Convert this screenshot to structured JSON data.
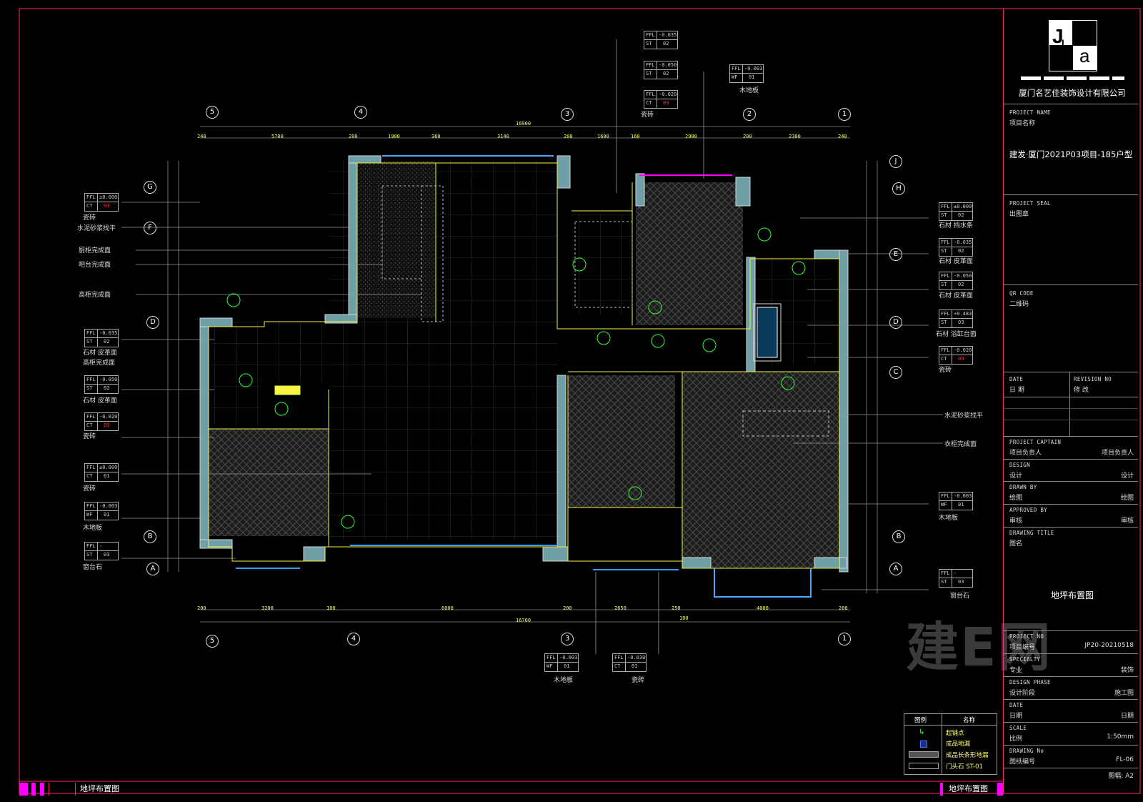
{
  "title_block": {
    "company": "厦门名艺佳装饰设计有限公司",
    "logo_text": "JLa",
    "project_name_en": "PROJECT NAME",
    "project_name_cn": "项目名称",
    "project_name_value": "建发·厦门2021P03项目-185户型",
    "project_seal_en": "PROJECT SEAL",
    "project_seal_cn": "出图章",
    "qr_en": "QR CODE",
    "qr_cn": "二维码",
    "date_en": "DATE",
    "date_cn": "日 期",
    "revision_en": "REVISION NO",
    "revision_cn": "修 改",
    "captain_en": "PROJECT CAPTAIN",
    "captain_cn": "项目负责人",
    "captain_value": "项目负责人",
    "design_en": "DESIGN",
    "design_cn": "设计",
    "design_value": "设计",
    "drawn_en": "DRAWN BY",
    "drawn_cn": "绘图",
    "drawn_value": "绘图",
    "approved_en": "APPROVED BY",
    "approved_cn": "审核",
    "approved_value": "审核",
    "dtitle_en": "DRAWING TITLE",
    "dtitle_cn": "图名",
    "drawing_title": "地坪布置图",
    "project_no_en": "PROJECT NO",
    "project_no_cn": "项目编号",
    "project_no_value": "JP20-20210518",
    "specialty_en": "SPECIALTY",
    "specialty_cn": "专业",
    "specialty_value": "装饰",
    "phase_en": "DESIGN PHASE",
    "phase_cn": "设计阶段",
    "phase_value": "施工图",
    "date2_en": "DATE",
    "date2_cn": "日期",
    "date2_value": "日期",
    "scale_en": "SCALE",
    "scale_cn": "比例",
    "scale_value": "1:50mm",
    "drawing_no_en": "DRAWING No",
    "drawing_no_cn": "图纸编号",
    "drawing_no_value": "FL-06",
    "sheet_size": "图幅: A2"
  },
  "watermark": "建E网",
  "bottom_bar": {
    "left_title": "地坪布置图",
    "right_title": "地坪布置图"
  },
  "legend": {
    "head_symbol": "图例",
    "head_name": "名称",
    "items": [
      "起铺点",
      "成品地漏",
      "成品长条形地漏",
      "门头石 ST-01"
    ]
  },
  "axes": {
    "top": [
      "5",
      "4",
      "3",
      "2",
      "1"
    ],
    "bottom": [
      "5",
      "4",
      "3",
      "1"
    ],
    "left": [
      "G",
      "F",
      "D",
      "B",
      "A"
    ],
    "right": [
      "J",
      "H",
      "E",
      "D",
      "C",
      "B",
      "A"
    ]
  },
  "dims_top": [
    "240",
    "5700",
    "200",
    "1900",
    "360",
    "3140",
    "200",
    "1600",
    "160",
    "2900",
    "200",
    "2300",
    "240"
  ],
  "dim_top_total": "16900",
  "dims_bottom": [
    "200",
    "3200",
    "100",
    "6000",
    "200",
    "2650",
    "250",
    "4000",
    "200"
  ],
  "dim_bottom_total": "16700",
  "dim_bottom_sub": "100",
  "left_notes": [
    "瓷砖",
    "水泥砂浆找平",
    "厨柜完成面",
    "吧台完成面",
    "高柜完成面",
    "石材 皮革面",
    "高柜完成面",
    "石材 皮革面",
    "瓷砖",
    "瓷砖",
    "木地板",
    "窗台石"
  ],
  "right_notes": [
    "石材 挡水条",
    "石材 皮革面",
    "石材 皮革面",
    "石材 浴缸台面",
    "瓷砖",
    "水泥砂浆找平",
    "衣柜完成面",
    "木地板",
    "窗台石"
  ],
  "top_notes": [
    "瓷砖",
    "木地板"
  ],
  "bottom_notes": [
    "木地板",
    "瓷砖"
  ],
  "tags_left": [
    {
      "a": "FFL",
      "b": "±0.000",
      "c": "CT",
      "d": "03"
    },
    {
      "a": "FFL",
      "b": "-0.035",
      "c": "ST",
      "d": "02"
    },
    {
      "a": "FFL",
      "b": "-0.050",
      "c": "ST",
      "d": "02"
    },
    {
      "a": "FFL",
      "b": "-0.020",
      "c": "CT",
      "d": "03"
    },
    {
      "a": "FFL",
      "b": "±0.000",
      "c": "CT",
      "d": "01"
    },
    {
      "a": "FFL",
      "b": "-0.003",
      "c": "WF",
      "d": "01"
    },
    {
      "a": "FFL",
      "b": "-",
      "c": "ST",
      "d": "03"
    }
  ],
  "tags_right": [
    {
      "a": "FFL",
      "b": "±0.000",
      "c": "ST",
      "d": "02"
    },
    {
      "a": "FFL",
      "b": "-0.035",
      "c": "ST",
      "d": "02"
    },
    {
      "a": "FFL",
      "b": "-0.050",
      "c": "ST",
      "d": "02"
    },
    {
      "a": "FFL",
      "b": "+0.483",
      "c": "ST",
      "d": "03"
    },
    {
      "a": "FFL",
      "b": "-0.020",
      "c": "CT",
      "d": "03"
    },
    {
      "a": "FFL",
      "b": "-0.003",
      "c": "WF",
      "d": "01"
    },
    {
      "a": "FFL",
      "b": "-",
      "c": "ST",
      "d": "03"
    }
  ],
  "tags_top": [
    {
      "a": "FFL",
      "b": "-0.035",
      "c": "ST",
      "d": "02"
    },
    {
      "a": "FFL",
      "b": "-0.050",
      "c": "ST",
      "d": "02"
    },
    {
      "a": "FFL",
      "b": "-0.020",
      "c": "CT",
      "d": "03"
    },
    {
      "a": "FFL",
      "b": "-0.003",
      "c": "WF",
      "d": "01"
    }
  ],
  "tags_bottom": [
    {
      "a": "FFL",
      "b": "-0.003",
      "c": "WF",
      "d": "01"
    },
    {
      "a": "FFL",
      "b": "-0.030",
      "c": "CT",
      "d": "01"
    }
  ],
  "colors": {
    "wall": "#6fa0a8",
    "outline": "#f5f542",
    "accent": "#ff2a6d",
    "green": "#33ff33",
    "magenta": "#ff00ff",
    "grid": "#888"
  }
}
